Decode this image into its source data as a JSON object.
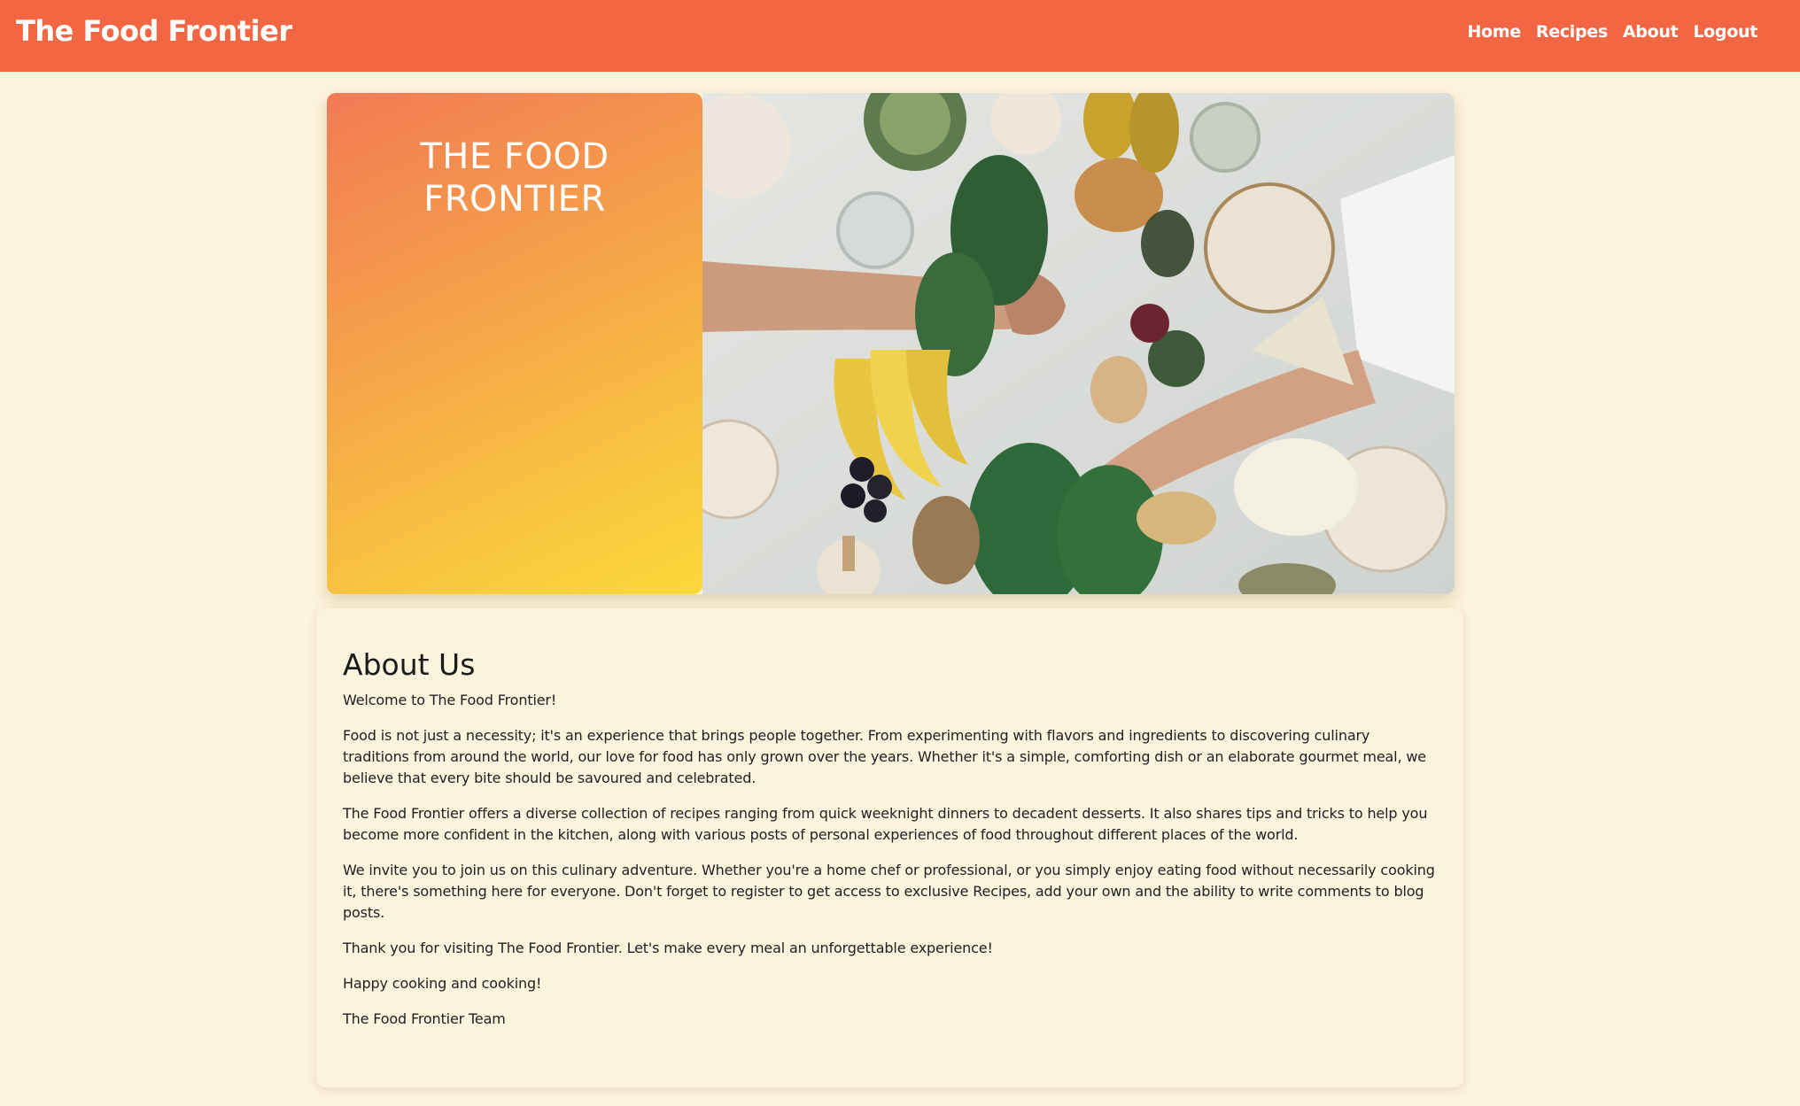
{
  "navbar": {
    "brand": "The Food Frontier",
    "links": [
      {
        "label": "Home"
      },
      {
        "label": "Recipes"
      },
      {
        "label": "About"
      },
      {
        "label": "Logout"
      }
    ]
  },
  "hero": {
    "title": "THE FOOD\nFRONTIER",
    "image_alt": "Overhead view of a grazing table with fruits, cheeses and vegetables"
  },
  "about": {
    "heading": "About Us",
    "paragraphs": [
      "Welcome to The Food Frontier!",
      "Food is not just a necessity; it's an experience that brings people together. From experimenting with flavors and ingredients to discovering culinary traditions from around the world, our love for food has only grown over the years. Whether it's a simple, comforting dish or an elaborate gourmet meal, we believe that every bite should be savoured and celebrated.",
      "The Food Frontier offers a diverse collection of recipes ranging from quick weeknight dinners to decadent desserts. It also shares tips and tricks to help you become more confident in the kitchen, along with various posts of personal experiences of food throughout different places of the world.",
      "We invite you to join us on this culinary adventure. Whether you're a home chef or professional, or you simply enjoy eating food without necessarily cooking it, there's something here for everyone. Don't forget to register to get access to exclusive Recipes, add your own and the ability to write comments to blog posts.",
      "Thank you for visiting The Food Frontier. Let's make every meal an unforgettable experience!",
      "Happy cooking and cooking!",
      "The Food Frontier Team"
    ]
  },
  "colors": {
    "navbar": "#f26644",
    "page_background": "#fdf4dc",
    "gradient_start": "#f27a55",
    "gradient_end": "#fbd93a"
  }
}
